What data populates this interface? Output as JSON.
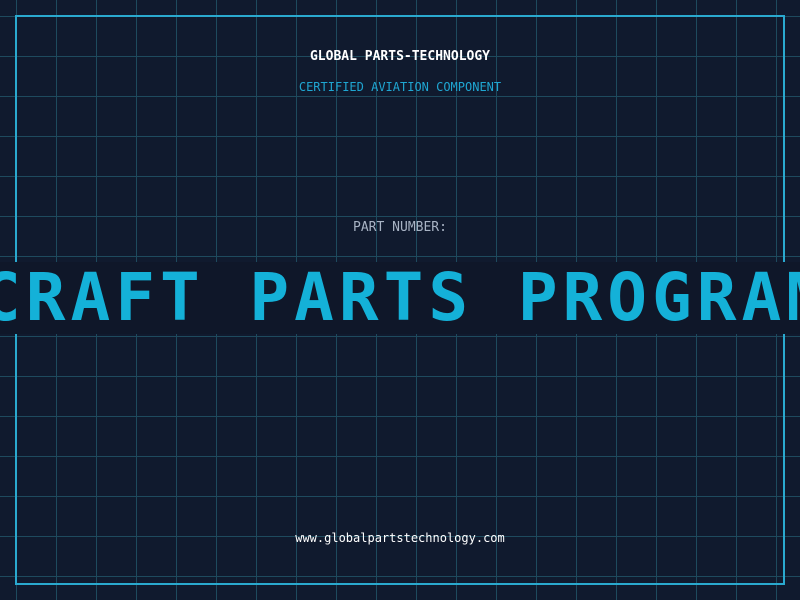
{
  "header": {
    "company": "GLOBAL PARTS-TECHNOLOGY",
    "tagline": "CERTIFIED AVIATION COMPONENT"
  },
  "part": {
    "label": "PART NUMBER:",
    "value": "CRAFT PARTS PROGRAM"
  },
  "footer": {
    "url": "www.globalpartstechnology.com"
  },
  "colors": {
    "background": "#101a2e",
    "grid": "#1e4a5e",
    "accent": "#14b1d8",
    "frame": "#2aa9cf"
  }
}
